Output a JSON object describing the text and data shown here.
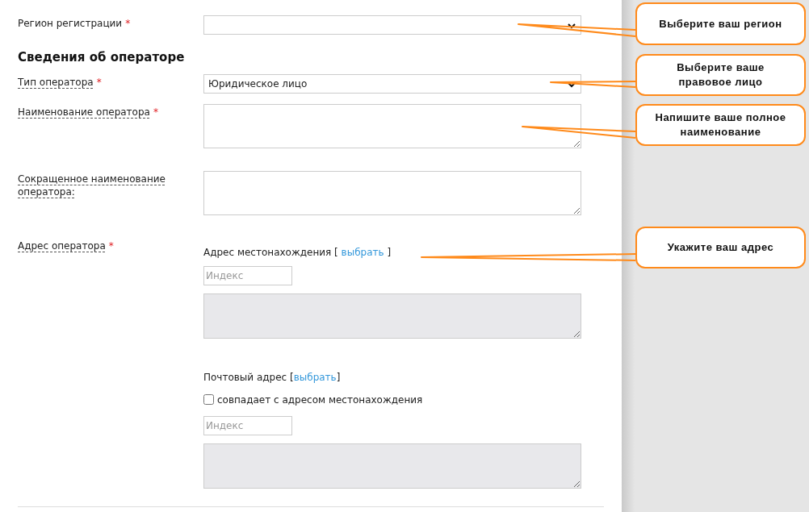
{
  "region_field": {
    "label": "Регион регистрации",
    "required_mark": "*",
    "help_link": false
  },
  "section_title": "Сведения об операторе",
  "operator_fields": [
    {
      "kind": "select",
      "label": "Тип оператора",
      "required_mark": "*",
      "help_link": true,
      "value": "Юридическое лицо"
    },
    {
      "kind": "textarea",
      "label": "Наименование оператора",
      "required_mark": "*",
      "help_link": true
    },
    {
      "kind": "textarea",
      "label": "Сокращенное наименование оператора:",
      "help_link": true
    }
  ],
  "address": {
    "label": "Адрес оператора",
    "required_mark": "*",
    "help_link": true,
    "blocks": [
      {
        "text": "Адрес местонахождения [ ",
        "link": "выбрать",
        "close": " ]",
        "index_placeholder": "Индекс",
        "address_disabled": true
      },
      {
        "text": "Почтовый адрес [",
        "link": "выбрать",
        "close": "]",
        "checkbox": {
          "label": "совпадает с адресом местонахождения",
          "checked": false
        },
        "index_placeholder": "Индекс",
        "address_disabled": true
      }
    ]
  },
  "callouts": [
    {
      "text": "Выберите ваш регион"
    },
    {
      "text": "Выберите ваше правовое лицо"
    },
    {
      "text": "Напишите ваше полное наименование"
    },
    {
      "text": "Укажите ваш адрес"
    }
  ]
}
